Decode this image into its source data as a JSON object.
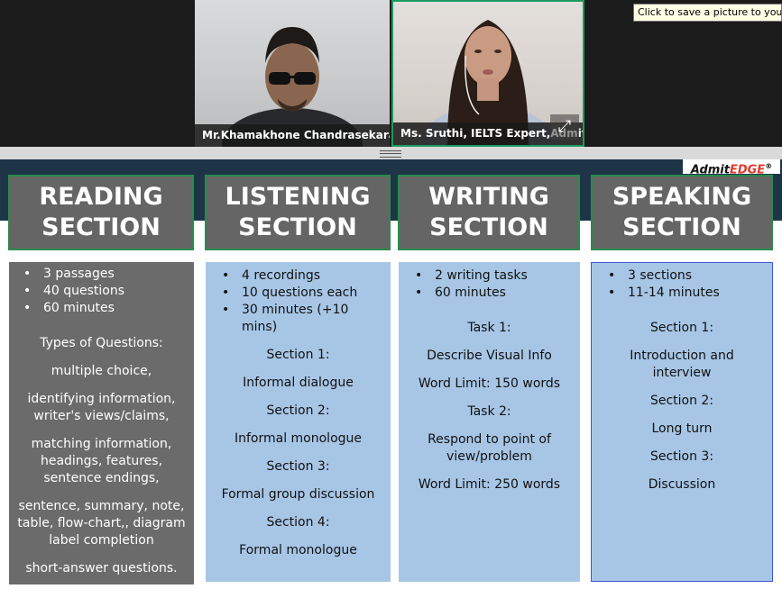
{
  "meeting": {
    "participants": [
      {
        "name": "Mr.Khamakhone Chandrasekaran"
      },
      {
        "name": "Ms. Sruthi, IELTS Expert,AdmitEDG..."
      }
    ],
    "tooltip": "Click to save a picture to your d",
    "expand_icon": "expand-arrows-icon"
  },
  "slide": {
    "logo": {
      "part1": "Admit",
      "part2": "EDGE",
      "mark": "®"
    },
    "colors": {
      "band": "#1e3548",
      "header_bg": "#646564",
      "header_border": "#2a8b4c",
      "box_blue": "#a7c6e6",
      "box_gray": "#6b6b6b"
    },
    "reading": {
      "title1": "READING",
      "title2": "SECTION",
      "bullets": [
        "3 passages",
        "40 questions",
        "60 minutes"
      ],
      "types_title": "Types of Questions:",
      "types": [
        "multiple choice,",
        "identifying information, writer's views/claims,",
        "matching information, headings, features, sentence endings,",
        "sentence, summary, note, table, flow-chart,, diagram label completion",
        "short-answer questions."
      ]
    },
    "listening": {
      "title1": "LISTENING",
      "title2": "SECTION",
      "bullets": [
        "4 recordings",
        "10 questions each",
        "30 minutes (+10 mins)"
      ],
      "lines": [
        "Section 1:",
        "Informal dialogue",
        "Section 2:",
        "Informal monologue",
        "Section 3:",
        "Formal group discussion",
        "Section 4:",
        "Formal monologue"
      ]
    },
    "writing": {
      "title1": "WRITING",
      "title2": "SECTION",
      "bullets": [
        "2 writing tasks",
        "60 minutes"
      ],
      "lines": [
        "Task 1:",
        "Describe Visual Info",
        "Word Limit: 150 words",
        "Task 2:",
        "Respond to point of view/problem",
        "Word Limit: 250 words"
      ]
    },
    "speaking": {
      "title1": "SPEAKING",
      "title2": "SECTION",
      "bullets": [
        "3 sections",
        "11-14 minutes"
      ],
      "lines": [
        "Section 1:",
        "Introduction and interview",
        "Section 2:",
        "Long turn",
        "Section 3:",
        "Discussion"
      ]
    }
  }
}
